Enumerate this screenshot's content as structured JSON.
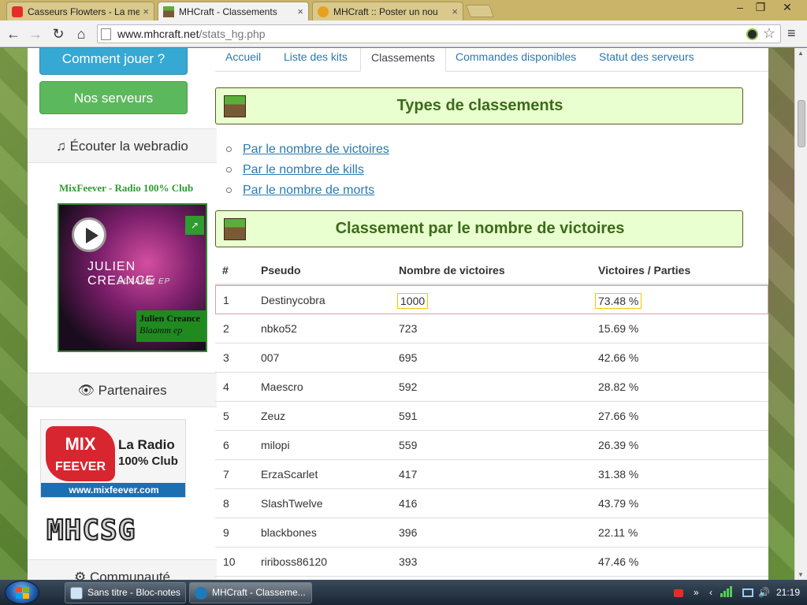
{
  "browser": {
    "tabs": [
      {
        "label": "Casseurs Flowters - La me",
        "favicon": "youtube-icon",
        "close": "×"
      },
      {
        "label": "MHCraft - Classements",
        "favicon": "minecraft-block-icon",
        "close": "×"
      },
      {
        "label": "MHCraft :: Poster un nou",
        "favicon": "forum-icon",
        "close": "×"
      }
    ],
    "window_controls": [
      "–",
      "❐",
      "✕"
    ],
    "nav_icons": {
      "back": "←",
      "forward": "→",
      "reload": "↻",
      "home": "⌂",
      "menu": "≡",
      "star": "☆"
    },
    "url_host": "www.mhcraft.net",
    "url_path": "/stats_hg.php"
  },
  "sidebar": {
    "how_to_play": "Comment jouer ?",
    "our_servers": "Nos serveurs",
    "webradio_header": "♫ Écouter la webradio",
    "radio_title": "MixFeever - Radio 100% Club",
    "album": {
      "artist": "JULIEN CREANCE",
      "subtitle": "BLAAMM EP",
      "tag_artist": "Julien Creance",
      "tag_title": "Blaamm ep",
      "share": "↗"
    },
    "partners_header": "👁 Partenaires",
    "partner_mix": {
      "logo_top": "MIX",
      "logo_bottom": "FEEVER",
      "line1": "La Radio",
      "line2": "100% Club",
      "url": "www.mixfeever.com"
    },
    "partner_mhcsg": "MHCSG",
    "community_header": "⚙ Communauté"
  },
  "main": {
    "nav": [
      {
        "label": "Accueil"
      },
      {
        "label": "Liste des kits"
      },
      {
        "label": "Classements"
      },
      {
        "label": "Commandes disponibles"
      },
      {
        "label": "Statut des serveurs"
      }
    ],
    "types_title": "Types de classements",
    "links": [
      "Par le nombre de victoires",
      "Par le nombre de kills",
      "Par le nombre de morts"
    ],
    "ranking_title": "Classement par le nombre de victoires",
    "table": {
      "headers": [
        "#",
        "Pseudo",
        "Nombre de victoires",
        "Victoires / Parties"
      ],
      "rows": [
        [
          "1",
          "Destinycobra",
          "1000",
          "73.48 %"
        ],
        [
          "2",
          "nbko52",
          "723",
          "15.69 %"
        ],
        [
          "3",
          "007",
          "695",
          "42.66 %"
        ],
        [
          "4",
          "Maescro",
          "592",
          "28.82 %"
        ],
        [
          "5",
          "Zeuz",
          "591",
          "27.66 %"
        ],
        [
          "6",
          "milopi",
          "559",
          "26.39 %"
        ],
        [
          "7",
          "ErzaScarlet",
          "417",
          "31.38 %"
        ],
        [
          "8",
          "SlashTwelve",
          "416",
          "43.79 %"
        ],
        [
          "9",
          "blackbones",
          "396",
          "22.11 %"
        ],
        [
          "10",
          "ririboss86120",
          "393",
          "47.46 %"
        ]
      ]
    }
  },
  "taskbar": {
    "tasks": [
      {
        "label": "Sans titre - Bloc-notes"
      },
      {
        "label": "MHCraft - Classeme..."
      }
    ],
    "tray_chevron": "»",
    "clock": "21:19"
  },
  "colors": {
    "accent_link": "#2a7ab0",
    "panel_bg": "#eaffcf",
    "panel_title": "#3a6b1a",
    "blue_button": "#35a9d4",
    "green_button": "#5cb85c"
  }
}
